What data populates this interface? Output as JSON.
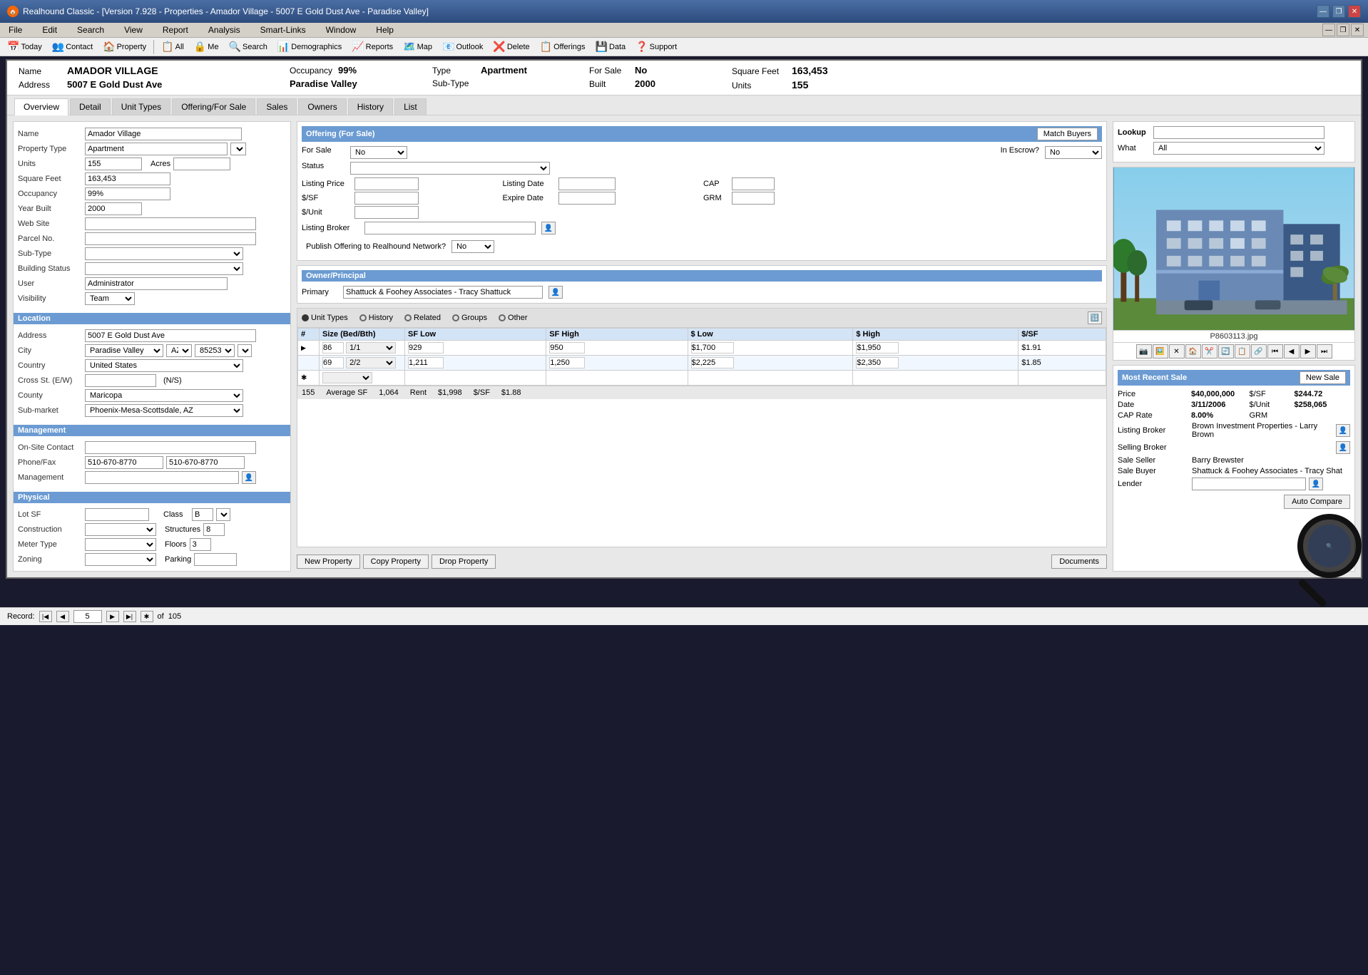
{
  "window": {
    "title": "Realhound Classic - [Version 7.928 - Properties - Amador Village - 5007 E Gold Dust Ave - Paradise Valley]",
    "icon": "🏠"
  },
  "titlebar": {
    "minimize": "—",
    "restore": "❐",
    "close": "✕",
    "minimize2": "—",
    "restore2": "❐",
    "close2": "✕"
  },
  "menu": {
    "items": [
      "File",
      "Edit",
      "Search",
      "View",
      "Report",
      "Analysis",
      "Smart-Links",
      "Window",
      "Help"
    ]
  },
  "toolbar": {
    "items": [
      "Today",
      "Contact",
      "Property",
      "All",
      "Me",
      "Search",
      "Demographics",
      "Reports",
      "Map",
      "Outlook",
      "Delete",
      "Offerings",
      "Data",
      "Support"
    ]
  },
  "header": {
    "name_label": "Name",
    "name_value": "AMADOR VILLAGE",
    "address_label": "Address",
    "address_value": "5007 E Gold Dust Ave",
    "occupancy_label": "Occupancy",
    "occupancy_value": "99%",
    "location_value": "Paradise Valley",
    "type_label": "Type",
    "type_value": "Apartment",
    "subtype_label": "Sub-Type",
    "for_sale_label": "For Sale",
    "for_sale_value": "No",
    "built_label": "Built",
    "built_value": "2000",
    "sqft_label": "Square Feet",
    "sqft_value": "163,453",
    "units_label": "Units",
    "units_value": "155"
  },
  "tabs": {
    "items": [
      "Overview",
      "Detail",
      "Unit Types",
      "Offering/For Sale",
      "Sales",
      "Owners",
      "History",
      "List"
    ],
    "active": "Overview"
  },
  "form": {
    "name_label": "Name",
    "name_value": "Amador Village",
    "property_type_label": "Property Type",
    "property_type_value": "Apartment",
    "units_label": "Units",
    "units_value": "155",
    "acres_label": "Acres",
    "sqft_label": "Square Feet",
    "sqft_value": "163,453",
    "occupancy_label": "Occupancy",
    "occupancy_value": "99%",
    "year_built_label": "Year Built",
    "year_built_value": "2000",
    "website_label": "Web Site",
    "parcel_label": "Parcel No.",
    "subtype_label": "Sub-Type",
    "building_status_label": "Building Status",
    "user_label": "User",
    "user_value": "Administrator",
    "visibility_label": "Visibility",
    "visibility_value": "Team"
  },
  "location": {
    "header": "Location",
    "address_label": "Address",
    "address_value": "5007 E Gold Dust Ave",
    "city_label": "City",
    "city_value": "Paradise Valley",
    "state_value": "AZ",
    "zip_value": "85253",
    "country_label": "Country",
    "country_value": "United States",
    "cross_label": "Cross St. (E/W)",
    "cross_value": "(N/S)",
    "county_label": "County",
    "county_value": "Maricopa",
    "submarket_label": "Sub-market",
    "submarket_value": "Phoenix-Mesa-Scottsdale, AZ"
  },
  "management": {
    "header": "Management",
    "onsite_label": "On-Site Contact",
    "phone_label": "Phone/Fax",
    "phone_value": "510-670-8770",
    "fax_value": "510-670-8770",
    "mgmt_label": "Management"
  },
  "physical": {
    "header": "Physical",
    "lot_label": "Lot SF",
    "class_label": "Class",
    "class_value": "B",
    "construction_label": "Construction",
    "structures_label": "Structures",
    "structures_value": "8",
    "meter_label": "Meter Type",
    "floors_label": "Floors",
    "floors_value": "3",
    "zoning_label": "Zoning",
    "parking_label": "Parking"
  },
  "offering": {
    "header": "Offering (For Sale)",
    "match_buyers_label": "Match Buyers",
    "for_sale_label": "For Sale",
    "for_sale_value": "No",
    "in_escrow_label": "In Escrow?",
    "in_escrow_value": "No",
    "status_label": "Status",
    "listing_price_label": "Listing Price",
    "listing_date_label": "Listing Date",
    "cap_label": "CAP",
    "spsf_label": "$/SF",
    "expire_date_label": "Expire Date",
    "grm_label": "GRM",
    "spunit_label": "$/Unit",
    "listing_broker_label": "Listing Broker",
    "publish_label": "Publish Offering to Realhound Network?",
    "publish_value": "No"
  },
  "owner": {
    "header": "Owner/Principal",
    "primary_label": "Primary",
    "primary_value": "Shattuck & Foohey Associates - Tracy Shattuck"
  },
  "unit_types": {
    "tabs": [
      "Unit Types",
      "History",
      "Related",
      "Groups",
      "Other"
    ],
    "active": "Unit Types",
    "columns": [
      "#",
      "Size (Bed/Bth)",
      "SF Low",
      "SF High",
      "$ Low",
      "$ High",
      "$/SF"
    ],
    "rows": [
      {
        "num": "86",
        "size": "1/1",
        "sf_low": "929",
        "sf_high": "950",
        "low": "$1,700",
        "high": "$1,950",
        "psf": "$1.91"
      },
      {
        "num": "69",
        "size": "2/2",
        "sf_low": "1,211",
        "sf_high": "1,250",
        "low": "$2,225",
        "high": "$2,350",
        "psf": "$1.85"
      }
    ],
    "footer_total": "155",
    "footer_avg_sf_label": "Average SF",
    "footer_avg_sf": "1,064",
    "footer_rent_label": "Rent",
    "footer_rent": "$1,998",
    "footer_psf_label": "$/SF",
    "footer_psf": "$1.88"
  },
  "lookup": {
    "label": "Lookup",
    "what_label": "What",
    "what_value": "All"
  },
  "image": {
    "filename": "P8603113.jpg",
    "alt": "Apartment building photo"
  },
  "most_recent_sale": {
    "header": "Most Recent Sale",
    "new_sale_label": "New Sale",
    "price_label": "Price",
    "price_value": "$40,000,000",
    "psf_label": "$/SF",
    "psf_value": "$244.72",
    "date_label": "Date",
    "date_value": "3/11/2006",
    "pu_label": "$/Unit",
    "pu_value": "$258,065",
    "cap_label": "CAP Rate",
    "cap_value": "8.00%",
    "grm_label": "GRM",
    "listing_broker_label": "Listing Broker",
    "listing_broker_value": "Brown Investment Properties - Larry Brown",
    "selling_broker_label": "Selling Broker",
    "sale_seller_label": "Sale Seller",
    "sale_seller_value": "Barry Brewster",
    "sale_buyer_label": "Sale Buyer",
    "sale_buyer_value": "Shattuck & Foohey Associates - Tracy Shat",
    "lender_label": "Lender",
    "auto_compare_label": "Auto Compare"
  },
  "bottom_buttons": {
    "new_property": "New Property",
    "copy_property": "Copy Property",
    "drop_property": "Drop Property",
    "documents": "Documents"
  },
  "status_bar": {
    "record_label": "Record:",
    "current": "5",
    "total": "105"
  }
}
